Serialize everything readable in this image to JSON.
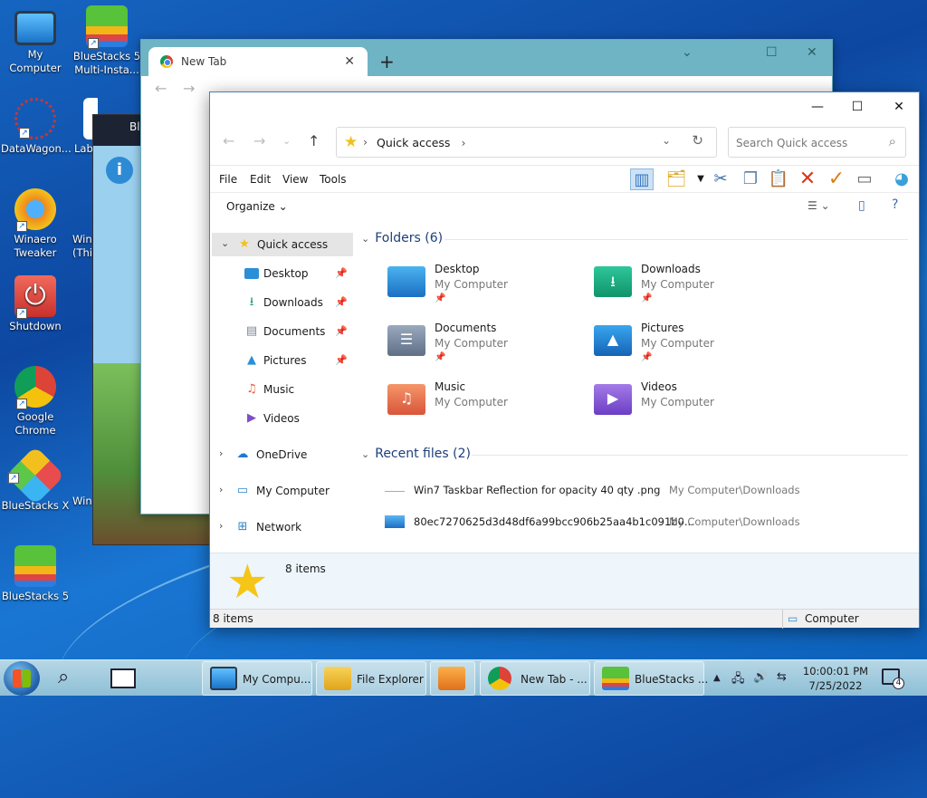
{
  "desktop": {
    "icons": [
      {
        "label": "My Computer"
      },
      {
        "label": "BlueStacks 5 Multi-Insta..."
      },
      {
        "label": "DataWagon..."
      },
      {
        "label": "Lab"
      },
      {
        "label": "Winaero Tweaker"
      },
      {
        "label": "Win (Thi"
      },
      {
        "label": "Shutdown"
      },
      {
        "label": "Google Chrome"
      },
      {
        "label": "BlueStacks X"
      },
      {
        "label": "Win"
      },
      {
        "label": "BlueStacks 5"
      }
    ]
  },
  "bluestacks_window": {
    "title": "Bl"
  },
  "chrome": {
    "tab_title": "New Tab",
    "close": "✕",
    "new_tab": "+",
    "ctl_min": "⌄",
    "ctl_max": "☐",
    "ctl_close": "✕"
  },
  "explorer": {
    "controls": {
      "min": "—",
      "max": "☐",
      "close": "✕"
    },
    "address": {
      "crumb": "Quick access",
      "dropdown": "⌄",
      "refresh": "↻"
    },
    "search_placeholder": "Search Quick access",
    "menu": [
      "File",
      "Edit",
      "View",
      "Tools"
    ],
    "organize": "Organize ⌄",
    "nav": {
      "quick_access": "Quick access",
      "items": [
        "Desktop",
        "Downloads",
        "Documents",
        "Pictures",
        "Music",
        "Videos"
      ],
      "onedrive": "OneDrive",
      "my_computer": "My Computer",
      "network": "Network"
    },
    "folders_header": "Folders (6)",
    "folders": [
      {
        "name": "Desktop",
        "location": "My Computer",
        "pinned": "📌"
      },
      {
        "name": "Downloads",
        "location": "My Computer",
        "pinned": "📌"
      },
      {
        "name": "Documents",
        "location": "My Computer",
        "pinned": "📌"
      },
      {
        "name": "Pictures",
        "location": "My Computer",
        "pinned": "📌"
      },
      {
        "name": "Music",
        "location": "My Computer"
      },
      {
        "name": "Videos",
        "location": "My Computer"
      }
    ],
    "recent_header": "Recent files (2)",
    "recent": [
      {
        "name": "Win7 Taskbar Reflection for opacity 40 qty .png",
        "path": "My Computer\\Downloads"
      },
      {
        "name": "80ec7270625d3d48df6a99bcc906b25aa4b1c091b0...",
        "path": "My Computer\\Downloads"
      }
    ],
    "details_count": "8 items",
    "status_count": "8 items",
    "status_location": "Computer"
  },
  "taskbar": {
    "buttons": [
      {
        "label": "My Compu..."
      },
      {
        "label": "File Explorer"
      },
      {
        "label": ""
      },
      {
        "label": "New Tab - ..."
      },
      {
        "label": "BlueStacks ..."
      }
    ],
    "time": "10:00:01 PM",
    "date": "7/25/2022",
    "notifications": "4"
  },
  "colors": {
    "accent": "#0078d7",
    "folder_blue": "#2b8fd8",
    "star": "#f5c518"
  }
}
